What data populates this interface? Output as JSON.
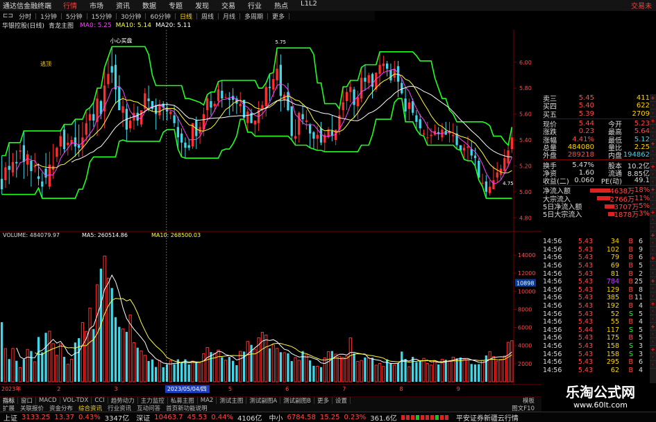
{
  "menu": {
    "app_title": "通达信金融终端",
    "items": [
      "行情",
      "市场",
      "资讯",
      "数据",
      "专题",
      "发现",
      "交易",
      "行业",
      "热点",
      "L1L2"
    ],
    "active": 0,
    "right": "交易未"
  },
  "toolbar": {
    "items": [
      "分时",
      "1分钟",
      "5分钟",
      "15分钟",
      "30分钟",
      "60分钟",
      "日线",
      "周线",
      "月线",
      "多周期",
      "更多"
    ],
    "active": 6
  },
  "indicator_line": {
    "stock": "华银控股(日线)",
    "indicator": "青龙主图",
    "ma": [
      {
        "label": "MA0: 5.25",
        "color": "#ff40ff"
      },
      {
        "label": "MA10: 5.14",
        "color": "#ffff40"
      },
      {
        "label": "MA20: 5.11",
        "color": "#ffffff"
      }
    ]
  },
  "chart_data": {
    "type": "candlestick",
    "annotations": [
      "小心买盘",
      "逃顶",
      "5.75",
      "4.75"
    ],
    "price_axis": {
      "ticks": [
        "6.00",
        "5.80",
        "5.60",
        "5.40",
        "5.20",
        "5.00",
        "4.80"
      ],
      "range": [
        4.7,
        6.25
      ]
    },
    "volume_header": {
      "label": "VOLUME: 484079.97",
      "ma5": "MA5: 260514.86",
      "ma10": "MA10: 268500.03"
    },
    "volume_axis": {
      "ticks": [
        "14000",
        "12000",
        "10000",
        "8000",
        "6000",
        "4000",
        "2000"
      ],
      "highlight": "10898",
      "range": [
        0,
        15000
      ]
    },
    "date_axis": {
      "labels": [
        "2023年",
        "2",
        "3",
        "4",
        "5",
        "6",
        "7",
        "8",
        "9"
      ],
      "highlight": "2023/05/04/四"
    },
    "ohlcv": [
      [
        5.1,
        5.02,
        5.28,
        4.98,
        6.58
      ],
      [
        5.09,
        5.19,
        5.23,
        5.03,
        3.67
      ],
      [
        5.2,
        5.17,
        5.38,
        5.06,
        2.51
      ],
      [
        5.15,
        5.23,
        5.3,
        5.12,
        3.68
      ],
      [
        5.23,
        5.22,
        5.32,
        5.11,
        2.32
      ],
      [
        5.31,
        5.32,
        5.37,
        5.25,
        1.58
      ],
      [
        5.36,
        5.23,
        5.47,
        5.1,
        2.49
      ],
      [
        5.21,
        5.29,
        5.32,
        5.12,
        3.58
      ],
      [
        5.24,
        5.16,
        5.28,
        5.04,
        3.4
      ],
      [
        5.19,
        5.2,
        5.3,
        5.15,
        2.22
      ],
      [
        5.12,
        5.1,
        5.22,
        5.05,
        4.95
      ],
      [
        5.08,
        5.04,
        5.15,
        4.95,
        3.25
      ],
      [
        5.18,
        5.11,
        5.3,
        5.06,
        5.41
      ],
      [
        5.04,
        5.21,
        5.31,
        5.02,
        5.59
      ],
      [
        5.17,
        5.2,
        5.37,
        5.1,
        4.22
      ],
      [
        5.27,
        5.34,
        5.35,
        5.23,
        2.93
      ],
      [
        5.35,
        5.43,
        5.47,
        5.28,
        4.2
      ],
      [
        5.48,
        5.33,
        5.52,
        5.3,
        2.76
      ],
      [
        5.36,
        5.38,
        5.45,
        5.28,
        1.96
      ],
      [
        5.37,
        5.4,
        5.43,
        5.32,
        2.5
      ],
      [
        5.42,
        5.35,
        5.56,
        5.27,
        4.34
      ],
      [
        5.36,
        5.34,
        5.52,
        5.27,
        4.82
      ],
      [
        5.34,
        5.42,
        5.54,
        5.27,
        6.55
      ],
      [
        5.44,
        5.53,
        5.63,
        5.39,
        5.57
      ],
      [
        5.55,
        5.6,
        5.65,
        5.4,
        8.14
      ],
      [
        5.6,
        5.55,
        5.69,
        5.5,
        5.83
      ],
      [
        5.54,
        5.72,
        5.8,
        5.43,
        10.72
      ],
      [
        5.7,
        5.6,
        5.71,
        5.56,
        12.5
      ],
      [
        5.62,
        5.82,
        5.96,
        5.49,
        13.89
      ],
      [
        5.83,
        5.91,
        6.04,
        5.8,
        11.45
      ],
      [
        5.97,
        5.92,
        6.12,
        5.84,
        10.36
      ],
      [
        5.98,
        5.79,
        6.06,
        5.68,
        7.14
      ],
      [
        5.81,
        5.63,
        5.9,
        5.63,
        6.07
      ],
      [
        5.61,
        5.66,
        5.74,
        5.5,
        5.84
      ],
      [
        5.64,
        5.48,
        5.68,
        5.39,
        5.52
      ],
      [
        5.49,
        5.55,
        5.59,
        5.46,
        7.38
      ],
      [
        5.55,
        5.61,
        5.68,
        5.48,
        4.32
      ],
      [
        5.61,
        5.55,
        5.66,
        5.51,
        3.77
      ],
      [
        5.52,
        5.63,
        5.63,
        5.5,
        3.42
      ],
      [
        5.64,
        5.76,
        5.8,
        5.61,
        2.93
      ],
      [
        5.72,
        5.7,
        5.82,
        5.62,
        2.3
      ],
      [
        5.7,
        5.64,
        5.7,
        5.62,
        2.47
      ],
      [
        5.67,
        5.6,
        5.72,
        5.48,
        1.64
      ],
      [
        5.59,
        5.67,
        5.71,
        5.56,
        2.35
      ],
      [
        5.68,
        5.65,
        5.7,
        5.55,
        1.61
      ],
      [
        5.65,
        5.62,
        5.69,
        5.55,
        1.94
      ],
      [
        5.6,
        5.62,
        5.63,
        5.56,
        2.34
      ],
      [
        5.59,
        5.53,
        5.67,
        5.5,
        1.95
      ],
      [
        5.5,
        5.42,
        5.58,
        5.33,
        2.48
      ],
      [
        5.45,
        5.38,
        5.49,
        5.27,
        2.13
      ],
      [
        5.38,
        5.34,
        5.42,
        5.26,
        2.48
      ],
      [
        5.36,
        5.34,
        5.41,
        5.32,
        1.91
      ],
      [
        5.35,
        5.53,
        5.53,
        5.33,
        2.29
      ],
      [
        5.55,
        5.43,
        5.58,
        5.33,
        2.17
      ],
      [
        5.45,
        5.5,
        5.54,
        5.37,
        2.07
      ],
      [
        5.48,
        5.6,
        5.65,
        5.43,
        3.11
      ],
      [
        5.63,
        5.72,
        5.75,
        5.56,
        3.79
      ],
      [
        5.7,
        5.65,
        5.77,
        5.59,
        3.28
      ],
      [
        5.66,
        5.68,
        5.7,
        5.62,
        3.15
      ],
      [
        5.7,
        5.79,
        5.85,
        5.66,
        3.51
      ],
      [
        5.78,
        5.72,
        5.86,
        5.65,
        2.72
      ],
      [
        5.73,
        5.73,
        5.76,
        5.72,
        2.39
      ],
      [
        5.72,
        5.71,
        5.77,
        5.59,
        2.75
      ],
      [
        5.74,
        5.71,
        5.8,
        5.62,
        2.32
      ],
      [
        5.72,
        5.68,
        5.74,
        5.6,
        1.84
      ],
      [
        5.66,
        5.68,
        5.77,
        5.61,
        3.36
      ],
      [
        5.71,
        5.57,
        5.71,
        5.56,
        3.34
      ],
      [
        5.53,
        5.62,
        5.64,
        5.46,
        4.46
      ],
      [
        5.61,
        5.53,
        5.64,
        5.53,
        4.08
      ],
      [
        5.52,
        5.55,
        5.55,
        5.43,
        3.6
      ],
      [
        5.53,
        5.63,
        5.7,
        5.47,
        4.86
      ],
      [
        5.64,
        5.67,
        5.7,
        5.56,
        5.47
      ],
      [
        5.66,
        5.81,
        5.84,
        5.58,
        5.17
      ],
      [
        5.81,
        5.8,
        5.91,
        5.7,
        3.7
      ],
      [
        5.79,
        5.87,
        5.92,
        5.73,
        4.08
      ],
      [
        5.86,
        5.95,
        6.11,
        5.79,
        3.69
      ],
      [
        5.98,
        5.74,
        6.06,
        5.62,
        3.27
      ],
      [
        5.71,
        5.75,
        5.77,
        5.65,
        3.22
      ],
      [
        5.77,
        5.63,
        5.84,
        5.62,
        3.14
      ],
      [
        5.66,
        5.43,
        5.66,
        5.4,
        2.29
      ],
      [
        5.41,
        5.43,
        5.56,
        5.36,
        2.67
      ],
      [
        5.44,
        5.61,
        5.62,
        5.38,
        2.38
      ],
      [
        5.6,
        5.56,
        5.68,
        5.52,
        3.39
      ],
      [
        5.54,
        5.55,
        5.63,
        5.48,
        2.99
      ],
      [
        5.52,
        5.45,
        5.53,
        5.34,
        2.36
      ],
      [
        5.46,
        5.41,
        5.47,
        5.33,
        1.77
      ],
      [
        5.41,
        5.44,
        5.51,
        5.32,
        1.72
      ],
      [
        5.49,
        5.38,
        5.54,
        5.36,
        1.62
      ],
      [
        5.38,
        5.44,
        5.46,
        5.31,
        2.65
      ],
      [
        5.42,
        5.48,
        5.5,
        5.41,
        3.33
      ],
      [
        5.47,
        5.43,
        5.59,
        5.39,
        3.4
      ],
      [
        5.4,
        5.48,
        5.48,
        5.36,
        3.06
      ],
      [
        5.48,
        5.59,
        5.64,
        5.44,
        2.78
      ],
      [
        5.63,
        5.69,
        5.81,
        5.57,
        2.71
      ],
      [
        5.7,
        5.77,
        5.8,
        5.63,
        2.82
      ],
      [
        5.77,
        5.81,
        5.86,
        5.69,
        4.85
      ],
      [
        5.79,
        5.67,
        5.81,
        5.57,
        3.14
      ],
      [
        5.66,
        5.73,
        5.78,
        5.56,
        2.26
      ],
      [
        5.72,
        5.88,
        5.96,
        5.69,
        2.36
      ],
      [
        5.88,
        5.85,
        5.98,
        5.78,
        2.69
      ],
      [
        5.84,
        5.9,
        5.92,
        5.79,
        2.62
      ],
      [
        5.91,
        5.81,
        5.92,
        5.72,
        2.66
      ],
      [
        5.79,
        5.92,
        5.92,
        5.77,
        1.84
      ],
      [
        5.91,
        5.98,
        6.08,
        5.81,
        2.03
      ],
      [
        5.97,
        5.99,
        6.05,
        5.92,
        1.7
      ],
      [
        5.99,
        5.95,
        6.01,
        5.89,
        2.48
      ],
      [
        5.94,
        5.86,
        5.99,
        5.84,
        2.08
      ],
      [
        5.88,
        5.95,
        6.01,
        5.85,
        1.86
      ],
      [
        5.97,
        5.85,
        6.01,
        5.73,
        2.06
      ],
      [
        5.84,
        5.76,
        5.88,
        5.75,
        3.34
      ],
      [
        5.72,
        5.62,
        5.8,
        5.54,
        2.52
      ],
      [
        5.64,
        5.69,
        5.72,
        5.55,
        1.67
      ],
      [
        5.7,
        5.61,
        5.72,
        5.59,
        2.75
      ],
      [
        5.59,
        5.54,
        5.63,
        5.48,
        2.18
      ],
      [
        5.56,
        5.49,
        5.6,
        5.44,
        2.38
      ],
      [
        5.45,
        5.45,
        5.48,
        5.43,
        2.59
      ],
      [
        5.42,
        5.42,
        5.54,
        5.36,
        2.03
      ],
      [
        5.43,
        5.44,
        5.49,
        5.37,
        1.85
      ],
      [
        5.44,
        5.47,
        5.52,
        5.43,
        2.33
      ],
      [
        5.46,
        5.45,
        5.5,
        5.4,
        1.92
      ],
      [
        5.42,
        5.48,
        5.53,
        5.39,
        2.5
      ],
      [
        5.47,
        5.44,
        5.54,
        5.44,
        2.43
      ],
      [
        5.45,
        5.47,
        5.54,
        5.38,
        2.33
      ],
      [
        5.43,
        5.44,
        5.53,
        5.38,
        2.72
      ],
      [
        5.45,
        5.36,
        5.51,
        5.33,
        2.58
      ],
      [
        5.36,
        5.32,
        5.36,
        5.32,
        2.69
      ],
      [
        5.32,
        5.34,
        5.37,
        5.25,
        2.53
      ],
      [
        5.34,
        5.35,
        5.43,
        5.24,
        2.4
      ],
      [
        5.33,
        5.28,
        5.39,
        5.25,
        1.97
      ],
      [
        5.28,
        5.26,
        5.34,
        5.2,
        1.92
      ],
      [
        5.24,
        5.11,
        5.26,
        5.09,
        1.95
      ],
      [
        5.07,
        5.07,
        5.14,
        5.04,
        2.37
      ],
      [
        5.08,
        5.0,
        5.13,
        4.95,
        2.91
      ],
      [
        4.99,
        5.04,
        5.09,
        4.97,
        3.34
      ],
      [
        5.02,
        5.09,
        5.2,
        5.02,
        2.79
      ],
      [
        5.11,
        5.15,
        5.23,
        5.07,
        2.29
      ],
      [
        5.13,
        5.18,
        5.21,
        5.09,
        2.47
      ],
      [
        5.16,
        5.26,
        5.33,
        5.15,
        2.84
      ],
      [
        5.22,
        5.32,
        5.36,
        5.19,
        4.36
      ],
      [
        5.33,
        5.42,
        5.5,
        5.3,
        4.54
      ]
    ]
  },
  "quote": {
    "book": [
      {
        "label": "卖三",
        "price": "5.45",
        "vol": "411"
      },
      {
        "label": "买四",
        "price": "5.40",
        "vol": "622"
      },
      {
        "label": "买五",
        "price": "5.39",
        "vol": "2709"
      }
    ],
    "stats": [
      {
        "l": "现价",
        "v": "5.44",
        "l2": "今开",
        "v2": "5.23"
      },
      {
        "l": "涨跌",
        "v": "0.23",
        "l2": "最高",
        "v2": "5.64"
      },
      {
        "l": "涨幅",
        "v": "4.41%",
        "l2": "最低",
        "v2": "5.12"
      },
      {
        "l": "总量",
        "v": "484080",
        "l2": "量比",
        "v2": "2.25"
      },
      {
        "l": "外盘",
        "v": "289218",
        "l2": "内盘",
        "v2": "194862"
      }
    ],
    "stats2": [
      {
        "l": "换手",
        "v": "5.47%",
        "l2": "股本",
        "v2": "10.2亿"
      },
      {
        "l": "净资",
        "v": "1.60",
        "l2": "流通",
        "v2": "8.85亿"
      },
      {
        "l": "收益(二)",
        "v": "0.060",
        "l2": "PE(动)",
        "v2": "49.1"
      }
    ],
    "flows": [
      {
        "l": "净流入额",
        "v": "4638万",
        "pct": "18%",
        "fill": 0.6
      },
      {
        "l": "大宗流入",
        "v": "2766万",
        "pct": "11%",
        "fill": 0.4
      },
      {
        "l": "5日净流入额",
        "v": "3707万",
        "pct": "5%",
        "fill": 0.3
      },
      {
        "l": "5日大宗流入",
        "v": "1878万",
        "pct": "3%",
        "fill": 0.2
      }
    ]
  },
  "ticks": [
    {
      "t": "14:56",
      "p": "5.43",
      "v": "34",
      "f": "B",
      "c": "6"
    },
    {
      "t": "14:56",
      "p": "5.43",
      "v": "102",
      "f": "B",
      "c": "9"
    },
    {
      "t": "14:56",
      "p": "5.43",
      "v": "79",
      "f": "B",
      "c": "6"
    },
    {
      "t": "14:56",
      "p": "5.43",
      "v": "69",
      "f": "B",
      "c": "5"
    },
    {
      "t": "14:56",
      "p": "5.43",
      "v": "81",
      "f": "B",
      "c": "2"
    },
    {
      "t": "14:56",
      "p": "5.43",
      "v": "784",
      "f": "B",
      "c": "25"
    },
    {
      "t": "14:56",
      "p": "5.43",
      "v": "129",
      "f": "B",
      "c": "8"
    },
    {
      "t": "14:56",
      "p": "5.43",
      "v": "385",
      "f": "B",
      "c": "11"
    },
    {
      "t": "14:56",
      "p": "5.43",
      "v": "192",
      "f": "B",
      "c": "4"
    },
    {
      "t": "14:56",
      "p": "5.43",
      "v": "52",
      "f": "S",
      "c": "5"
    },
    {
      "t": "14:56",
      "p": "5.43",
      "v": "55",
      "f": "B",
      "c": "4"
    },
    {
      "t": "14:56",
      "p": "5.44",
      "v": "117",
      "f": "S",
      "c": "5"
    },
    {
      "t": "14:56",
      "p": "5.43",
      "v": "175",
      "f": "B",
      "c": "5"
    },
    {
      "t": "14:56",
      "p": "5.43",
      "v": "158",
      "f": "S",
      "c": "3"
    },
    {
      "t": "14:56",
      "p": "5.43",
      "v": "158",
      "f": "S",
      "c": "3"
    },
    {
      "t": "14:56",
      "p": "5.43",
      "v": "295",
      "f": "B",
      "c": "6"
    },
    {
      "t": "14:56",
      "p": "5.43",
      "v": "62",
      "f": "B",
      "c": "4"
    }
  ],
  "bottom_tabs": [
    "指标",
    "窗口",
    "MACD",
    "VOL-TDX",
    "CCI",
    "趋势动力",
    "主力监控",
    "私募主图",
    "MA2",
    "测试主图",
    "测试副图A",
    "测试副图B",
    "更多",
    "设置"
  ],
  "bottom_tabs_end": "模板",
  "sub_tabs": [
    "扩展",
    "关联报价",
    "资金分布",
    "综合资讯",
    "行业资讯",
    "互动问答",
    "首页新功能说明"
  ],
  "sub_tabs_active": 3,
  "sub_tabs_end": "图文F10",
  "status": {
    "indexes": [
      {
        "name": "上证",
        "val": "3133.25",
        "chg": "13.37",
        "pct": "0.43%",
        "amt": "3347亿"
      },
      {
        "name": "深证",
        "val": "10463.7",
        "chg": "45.53",
        "pct": "0.44%",
        "amt": "4106亿"
      },
      {
        "name": "中小",
        "val": "6784.58",
        "chg": "15.25",
        "pct": "0.23%",
        "amt": "361.6亿"
      }
    ],
    "message": "平安证券新疆云行情"
  },
  "watermark": {
    "title": "乐淘公式网",
    "url": "www.60lt.com"
  },
  "colors": {
    "up": "#ff3030",
    "down": "#40d8e8",
    "band": "#20ff20",
    "grid": "#7a0000",
    "ma0": "#ff40ff",
    "ma10": "#ffff40",
    "ma20": "#ffffff"
  }
}
